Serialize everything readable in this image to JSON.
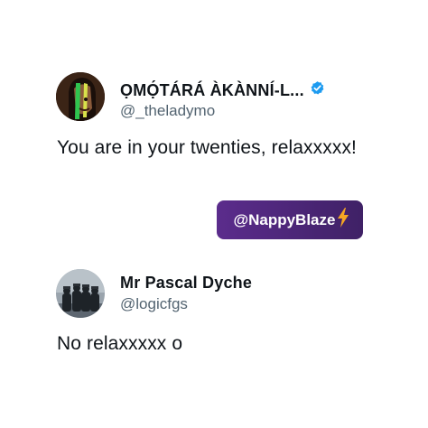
{
  "posts": [
    {
      "display_name": "ỌMỌ́TÁRÁ ÀKÀNNÍ-L...",
      "handle": "@_theladymo",
      "verified": true,
      "text": "You are in your twenties, relaxxxxx!",
      "avatar_icon": "woman-portrait-avatar-icon"
    },
    {
      "display_name": "Mr Pascal Dyche",
      "handle": "@logicfgs",
      "verified": false,
      "text": "No relaxxxxx o",
      "avatar_icon": "group-photo-avatar-icon"
    }
  ],
  "watermark": {
    "label": "@NappyBlaze",
    "icon": "lightning-bolt-icon",
    "bolt_color": "#f5a623",
    "bg_color": "#4a2578"
  },
  "colors": {
    "text": "#0f1419",
    "secondary": "#536471",
    "verified": "#1d9bf0"
  }
}
